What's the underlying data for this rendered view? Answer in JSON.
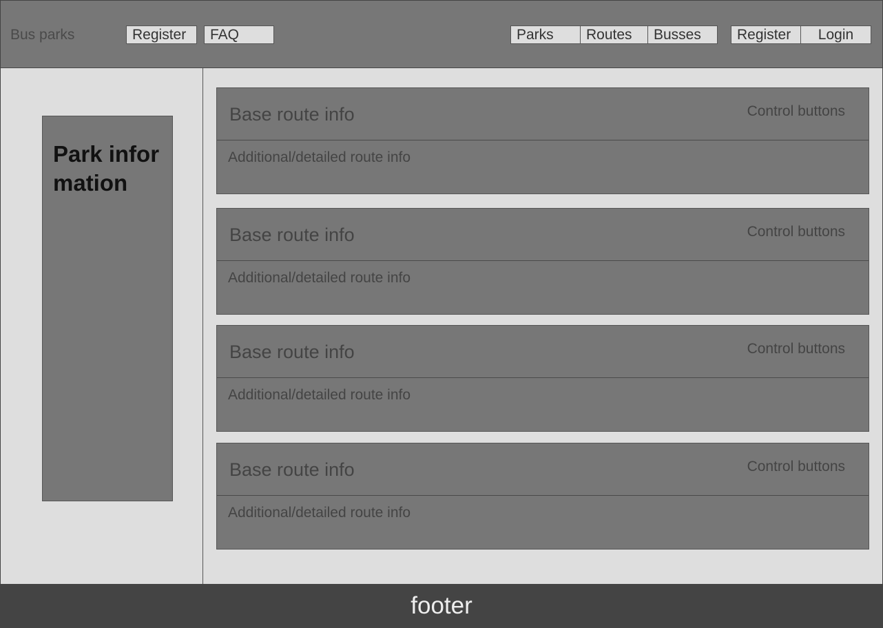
{
  "header": {
    "brand": "Bus parks",
    "left_nav": [
      "Register",
      "FAQ"
    ],
    "main_nav": [
      "Parks",
      "Routes",
      "Busses"
    ],
    "auth": {
      "register": "Register",
      "login": "Login"
    }
  },
  "sidebar": {
    "park_title": "Park information"
  },
  "routes": [
    {
      "base": "Base route info",
      "controls": "Control buttons",
      "detail": "Additional/detailed route info"
    },
    {
      "base": "Base route info",
      "controls": "Control buttons",
      "detail": "Additional/detailed route info"
    },
    {
      "base": "Base route info",
      "controls": "Control buttons",
      "detail": "Additional/detailed route info"
    },
    {
      "base": "Base route info",
      "controls": "Control buttons",
      "detail": "Additional/detailed route info"
    }
  ],
  "footer": {
    "label": "footer"
  }
}
